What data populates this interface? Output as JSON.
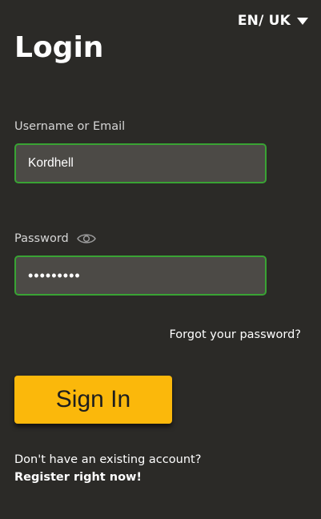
{
  "language": {
    "label": "EN/ UK",
    "icon": "chevron-down-icon"
  },
  "page": {
    "title": "Login"
  },
  "form": {
    "username": {
      "label": "Username or Email",
      "value": "Kordhell"
    },
    "password": {
      "label": "Password",
      "value": "•••••••••",
      "icon": "eye-icon"
    },
    "forgot_label": "Forgot your password?",
    "submit_label": "Sign In"
  },
  "register": {
    "prompt": "Don't have an existing account?",
    "link_label": "Register right now!"
  },
  "colors": {
    "background": "#2b2a27",
    "input_background": "#4c4a46",
    "input_border": "#39a334",
    "button": "#fbb80b"
  }
}
